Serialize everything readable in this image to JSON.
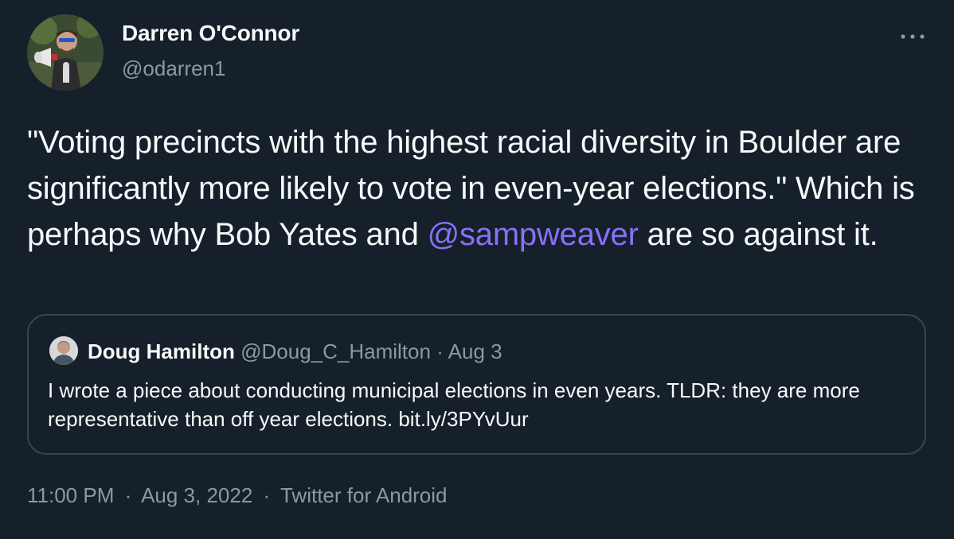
{
  "author": {
    "name": "Darren O'Connor",
    "handle": "@odarren1"
  },
  "tweet": {
    "text_before": "\"Voting precincts with the highest racial diversity in Boulder are significantly more likely to vote in even-year elections.\" Which is perhaps why Bob Yates and ",
    "mention": "@sampweaver",
    "text_after": " are so against it."
  },
  "quoted_tweet": {
    "name": "Doug Hamilton",
    "handle": "@Doug_C_Hamilton",
    "dot": "·",
    "date": "Aug 3",
    "text": "I wrote a piece about conducting municipal elections in even years. TLDR: they are more representative than off year elections. bit.ly/3PYvUur"
  },
  "footer": {
    "time": "11:00 PM",
    "separator": "·",
    "date": "Aug 3, 2022",
    "source": "Twitter for Android"
  },
  "colors": {
    "background": "#15202b",
    "text": "#f7f9f9",
    "secondary": "#8b98a5",
    "mention": "#8a70f5",
    "border": "#38444d"
  },
  "icons": {
    "more": "more-dots-icon"
  }
}
